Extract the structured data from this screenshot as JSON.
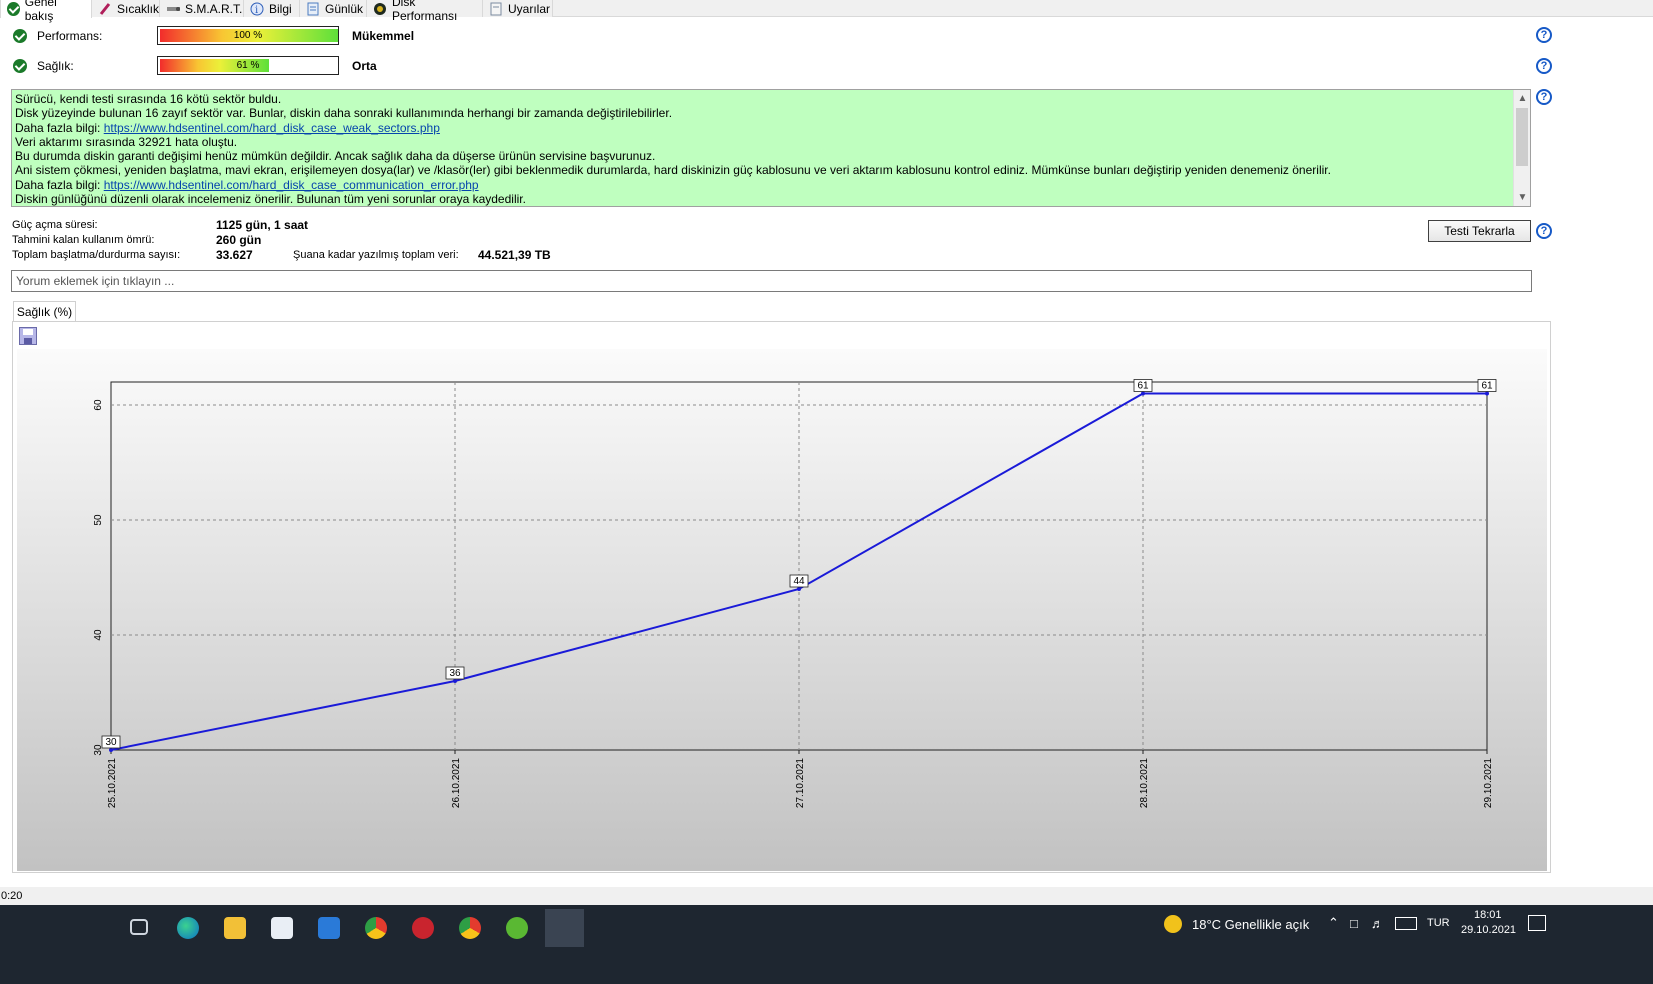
{
  "tabs": [
    {
      "label": "Genel bakış",
      "icon": "check-circle-icon",
      "active": true
    },
    {
      "label": "Sıcaklık",
      "icon": "thermometer-icon"
    },
    {
      "label": "S.M.A.R.T.",
      "icon": "smart-icon"
    },
    {
      "label": "Bilgi",
      "icon": "info-icon"
    },
    {
      "label": "Günlük",
      "icon": "log-icon"
    },
    {
      "label": "Disk Performansı",
      "icon": "speedometer-icon"
    },
    {
      "label": "Uyarılar",
      "icon": "alert-document-icon"
    }
  ],
  "performance": {
    "label": "Performans:",
    "percent_text": "100 %",
    "fill": 1.0,
    "status": "Mükemmel"
  },
  "health": {
    "label": "Sağlık:",
    "percent_text": "61 %",
    "fill": 0.61,
    "status": "Orta"
  },
  "messages": {
    "line1": "Sürücü, kendi testi sırasında 16 kötü sektör buldu.",
    "line2": "Disk yüzeyinde bulunan 16 zayıf sektör var. Bunlar, diskin daha sonraki kullanımında herhangi bir zamanda değiştirilebilirler.",
    "line3_prefix": "Daha fazla bilgi: ",
    "line3_link": "https://www.hdsentinel.com/hard_disk_case_weak_sectors.php",
    "line4": "Veri aktarımı sırasında 32921 hata oluştu.",
    "line5": "Bu durumda diskin garanti değişimi henüz mümkün değildir. Ancak sağlık daha da düşerse ürünün servisine başvurunuz.",
    "line6": "Ani sistem çökmesi, yeniden başlatma, mavi ekran, erişilemeyen dosya(lar) ve /klasör(ler) gibi beklenmedik durumlarda, hard diskinizin güç kablosunu ve veri aktarım kablosunu kontrol ediniz. Mümkünse bunları değiştirip yeniden denemeniz önerilir.",
    "line7_prefix": "Daha fazla bilgi: ",
    "line7_link": "https://www.hdsentinel.com/hard_disk_case_communication_error.php",
    "line8": "Diskin günlüğünü düzenli olarak incelemeniz önerilir. Bulunan tüm yeni sorunlar oraya kaydedilir."
  },
  "stats": {
    "power_on_label": "Güç açma süresi:",
    "power_on_value": "1125 gün, 1 saat",
    "lifetime_label": "Tahmini kalan kullanım ömrü:",
    "lifetime_value": "260 gün",
    "startstop_label": "Toplam başlatma/durdurma sayısı:",
    "startstop_value": "33.627",
    "written_label": "Şuana kadar yazılmış toplam veri:",
    "written_value": "44.521,39 TB"
  },
  "retest_button": "Testi Tekrarla",
  "help_symbol": "?",
  "comment_placeholder": "Yorum eklemek için tıklayın ...",
  "chart_tab": "Sağlık (%)",
  "chart_data": {
    "type": "line",
    "x": [
      "25.10.2021",
      "26.10.2021",
      "27.10.2021",
      "28.10.2021",
      "29.10.2021"
    ],
    "series": [
      {
        "values": [
          30,
          36,
          44,
          61,
          61
        ],
        "color": "#1a1ad8"
      }
    ],
    "ylim": [
      30,
      62
    ],
    "yticks": [
      30,
      40,
      50,
      60
    ],
    "grid": true
  },
  "status_strip": "0:20",
  "taskbar": {
    "weather": "18°C  Genellikle açık",
    "lang": "TUR",
    "time": "18:01",
    "date": "29.10.2021",
    "apps": [
      "task-view-icon",
      "edge-icon",
      "file-explorer-icon",
      "store-icon",
      "mail-icon",
      "chrome-icon",
      "game-icon",
      "chrome-profile-icon",
      "utorrent-icon",
      "hdsentinel-icon"
    ]
  }
}
